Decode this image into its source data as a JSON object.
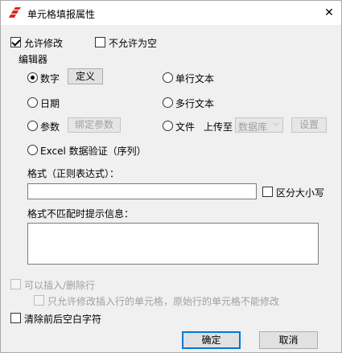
{
  "window": {
    "title": "单元格填报属性"
  },
  "allow_modify": {
    "label": "允许修改",
    "checked": true
  },
  "allow_empty": {
    "label": "不允许为空",
    "checked": false
  },
  "editor_group": {
    "label": "编辑器"
  },
  "radios": {
    "number": {
      "label": "数字",
      "checked": true
    },
    "single_text": {
      "label": "单行文本"
    },
    "date": {
      "label": "日期"
    },
    "multi_text": {
      "label": "多行文本"
    },
    "param": {
      "label": "参数"
    },
    "file": {
      "label": "文件"
    },
    "excel": {
      "label": "Excel 数据验证（序列）"
    }
  },
  "buttons": {
    "define": "定义",
    "bind_param": "绑定参数",
    "settings": "设置",
    "ok": "确定",
    "cancel": "取消"
  },
  "upload": {
    "label": "上传至",
    "select_value": "数据库"
  },
  "format": {
    "label": "格式（正则表达式）：",
    "value": ""
  },
  "case_sensitive": {
    "label": "区分大小写",
    "checked": false
  },
  "mismatch": {
    "label": "格式不匹配时提示信息：",
    "value": ""
  },
  "insert_delete": {
    "label": "可以插入/删除行",
    "checked": false
  },
  "only_modify_inserted": {
    "label": "只允许修改插入行的单元格，原始行的单元格不能修改",
    "checked": false
  },
  "trim_spaces": {
    "label": "清除前后空白字符",
    "checked": false
  },
  "colors": {
    "accent": "#0078d7",
    "icon_red": "#d9261c",
    "dialog_bg": "#f0f0f0",
    "disabled_text": "#a0a0a0"
  },
  "icons": {
    "app": "app-logo-icon",
    "close": "close-icon",
    "dropdown": "chevron-down-icon"
  }
}
